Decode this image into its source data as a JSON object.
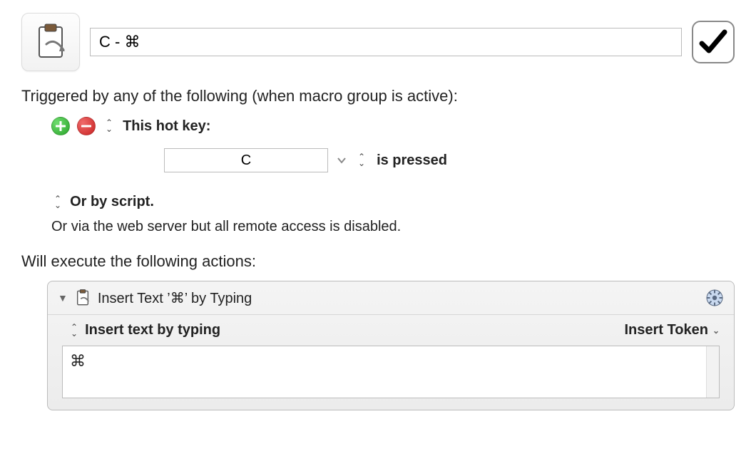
{
  "header": {
    "macro_title": "C - ⌘",
    "icon_name": "clipboard-icon",
    "enabled": true
  },
  "triggers": {
    "section_label": "Triggered by any of the following (when macro group is active):",
    "hotkey_label": "This hot key:",
    "hotkey_value": "C",
    "press_label": "is pressed",
    "or_script_label": "Or by script.",
    "web_server_label": "Or via the web server but all remote access is disabled."
  },
  "actions": {
    "section_label": "Will execute the following actions:",
    "items": [
      {
        "title": "Insert Text ’⌘’ by Typing",
        "mode_label": "Insert text by typing",
        "token_dropdown_label": "Insert Token",
        "text_value": "⌘"
      }
    ]
  }
}
